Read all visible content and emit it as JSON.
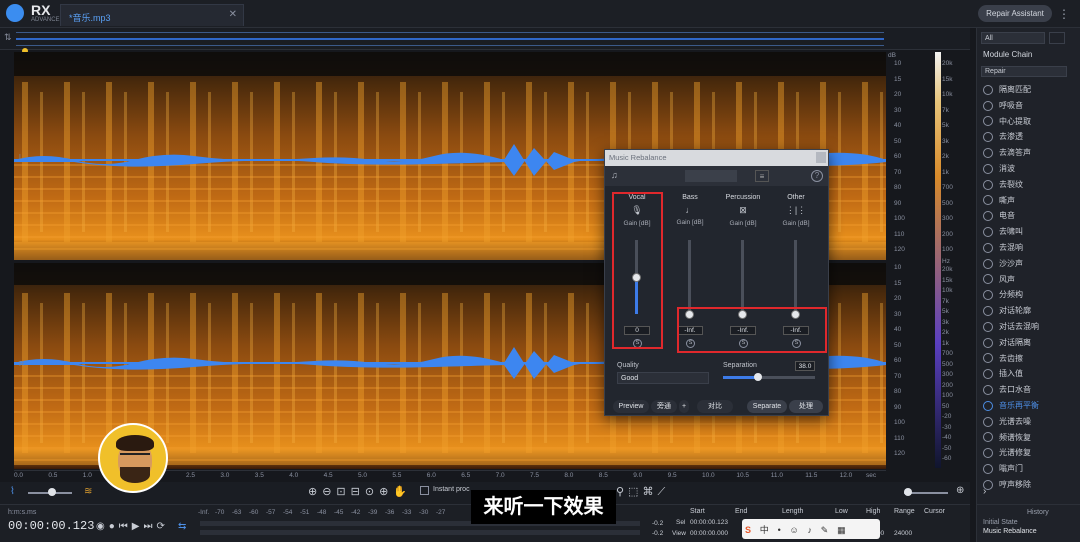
{
  "app": {
    "logo": "RX",
    "logo_sub": "ADVANCED",
    "tab_title": "*音乐.mp3",
    "repair_assistant": "Repair Assistant"
  },
  "spectrogram": {
    "channel_top": "L",
    "channel_bottom": "R",
    "db_header": "dB",
    "hz_header": "Hz",
    "db_scale": [
      "10",
      "15",
      "20",
      "30",
      "40",
      "50",
      "60",
      "70",
      "80",
      "90",
      "100",
      "110",
      "120"
    ],
    "hz_scale": [
      "20k",
      "15k",
      "10k",
      "7k",
      "5k",
      "3k",
      "2k",
      "1k",
      "700",
      "500",
      "300",
      "200",
      "100"
    ],
    "hz_scale_bottom": [
      "20k",
      "15k",
      "10k",
      "7k",
      "5k",
      "3k",
      "2k",
      "1k",
      "700",
      "500",
      "300",
      "200",
      "100",
      "50",
      "-20",
      "-30",
      "-40",
      "-50",
      "-60"
    ],
    "timeline": [
      "0.0",
      "0.5",
      "1.0",
      "1.5",
      "2.0",
      "2.5",
      "3.0",
      "3.5",
      "4.0",
      "4.5",
      "5.0",
      "5.5",
      "6.0",
      "6.5",
      "7.0",
      "7.5",
      "8.0",
      "8.5",
      "9.0",
      "9.5",
      "10.0",
      "10.5",
      "11.0",
      "11.5",
      "12.0",
      "sec"
    ]
  },
  "dialog": {
    "title": "Music Rebalance",
    "columns": [
      {
        "name": "Vocal",
        "icon": "microphone-icon",
        "gain_label": "Gain [dB]",
        "value": "0",
        "level": 0.5
      },
      {
        "name": "Bass",
        "icon": "bass-icon",
        "gain_label": "Gain [dB]",
        "value": "-Inf.",
        "level": 0.0
      },
      {
        "name": "Percussion",
        "icon": "drum-icon",
        "gain_label": "Gain [dB]",
        "value": "-Inf.",
        "level": 0.0
      },
      {
        "name": "Other",
        "icon": "waveform-icon",
        "gain_label": "Gain [dB]",
        "value": "-Inf.",
        "level": 0.0
      }
    ],
    "solo_label": "S",
    "quality_label": "Quality",
    "quality_value": "Good",
    "separation_label": "Separation",
    "separation_value": "38.0",
    "separation_level": 0.38,
    "buttons": {
      "preview": "Preview",
      "bypass": "旁通",
      "compare": "对比",
      "separate": "Separate",
      "process": "处理"
    }
  },
  "sidebar": {
    "filter": "All",
    "module_chain": "Module Chain",
    "category": "Repair",
    "modules": [
      "隔离匹配",
      "呼吸音",
      "中心提取",
      "去渗透",
      "去滴答声",
      "消波",
      "去裂纹",
      "嘶声",
      "电音",
      "去啸叫",
      "去混响",
      "沙沙声",
      "风声",
      "分频构",
      "对话轮廓",
      "对话去混响",
      "对话隔离",
      "去齿擦",
      "插入值",
      "去口水音",
      "音乐再平衡",
      "光谱去噪",
      "频谱恢复",
      "光谱修复",
      "嗡声门",
      "哼声移除"
    ],
    "active_module": "音乐再平衡"
  },
  "transport": {
    "time_label": "h:m:s.ms",
    "timecode": "00:00:00.123",
    "meter_ticks": [
      "-Inf.",
      "-70",
      "-63",
      "-60",
      "-57",
      "-54",
      "-51",
      "-48",
      "-45",
      "-42",
      "-39",
      "-36",
      "-33",
      "-30",
      "-27"
    ],
    "start_label": "Start",
    "end_label": "End",
    "length_label": "Length",
    "low_label": "Low",
    "high_label": "High",
    "range_label": "Range",
    "cursor_label": "Cursor",
    "sel_label": "Sel",
    "view_label": "View",
    "sel_start": "00:00:00.123",
    "view_start": "00:00:00.000",
    "high_value": "24000",
    "range_value": "24000",
    "instant_process": "Instant proc",
    "meter_r1": "-0.2",
    "meter_r2": "-0.2"
  },
  "history": {
    "title": "History",
    "item1": "Initial State",
    "item2": "Music Rebalance"
  },
  "subtitle": "来听一下效果"
}
